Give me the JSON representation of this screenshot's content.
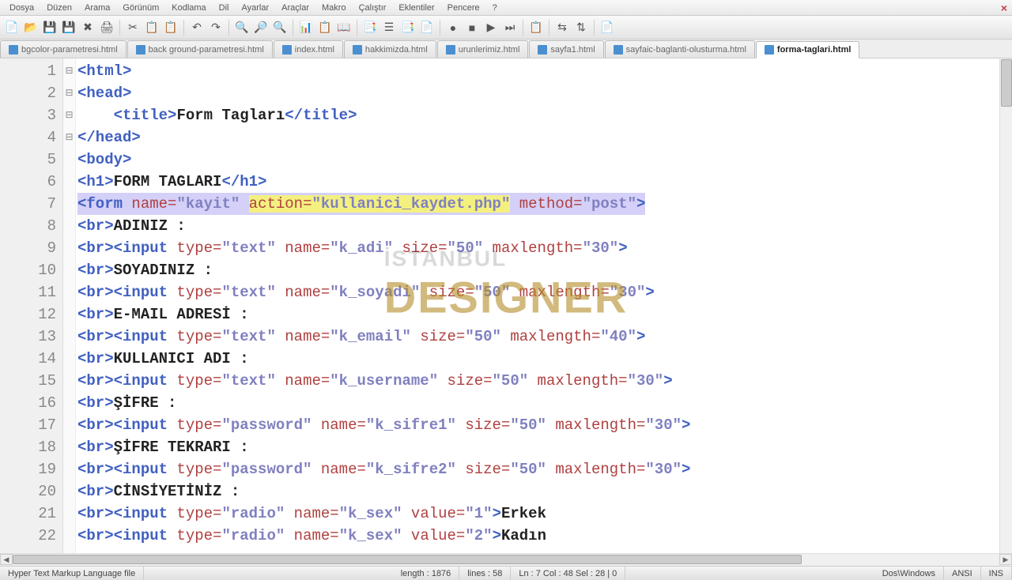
{
  "menu": {
    "items": [
      "Dosya",
      "Düzen",
      "Arama",
      "Görünüm",
      "Kodlama",
      "Dil",
      "Ayarlar",
      "Araçlar",
      "Makro",
      "Çalıştır",
      "Eklentiler",
      "Pencere",
      "?"
    ]
  },
  "tabs": [
    {
      "label": "bgcolor-parametresi.html",
      "active": false
    },
    {
      "label": "back ground-parametresi.html",
      "active": false
    },
    {
      "label": "index.html",
      "active": false
    },
    {
      "label": "hakkimizda.html",
      "active": false
    },
    {
      "label": "urunlerimiz.html",
      "active": false
    },
    {
      "label": "sayfa1.html",
      "active": false
    },
    {
      "label": "sayfaic-baglanti-olusturma.html",
      "active": false
    },
    {
      "label": "forma-taglari.html",
      "active": true
    }
  ],
  "lines": [
    {
      "n": 1,
      "fold": "⊟",
      "segs": [
        {
          "c": "tag",
          "t": "<html>"
        }
      ]
    },
    {
      "n": 2,
      "fold": "⊟",
      "segs": [
        {
          "c": "tag",
          "t": "<head>"
        }
      ]
    },
    {
      "n": 3,
      "fold": "",
      "segs": [
        {
          "c": "",
          "t": "    "
        },
        {
          "c": "tag",
          "t": "<title>"
        },
        {
          "c": "txt",
          "t": "Form Tagları"
        },
        {
          "c": "tag",
          "t": "</title>"
        }
      ]
    },
    {
      "n": 4,
      "fold": "",
      "segs": [
        {
          "c": "tag",
          "t": "</head>"
        }
      ]
    },
    {
      "n": 5,
      "fold": "⊟",
      "segs": [
        {
          "c": "tag",
          "t": "<body>"
        }
      ]
    },
    {
      "n": 6,
      "fold": "",
      "segs": [
        {
          "c": "tag",
          "t": "<h1>"
        },
        {
          "c": "txt",
          "t": "FORM TAGLARI"
        },
        {
          "c": "tag",
          "t": "</h1>"
        }
      ]
    },
    {
      "n": 7,
      "fold": "⊟",
      "hl": true,
      "segs": [
        {
          "c": "tag",
          "t": "<form "
        },
        {
          "c": "attr",
          "t": "name="
        },
        {
          "c": "str",
          "t": "\"kayit\""
        },
        {
          "c": "",
          "t": " "
        },
        {
          "c": "attr hl-act",
          "t": "action="
        },
        {
          "c": "str hl-act",
          "t": "\"kullanici_kaydet.php\""
        },
        {
          "c": "",
          "t": " "
        },
        {
          "c": "attr",
          "t": "method="
        },
        {
          "c": "str",
          "t": "\"post\""
        },
        {
          "c": "tag",
          "t": ">"
        }
      ]
    },
    {
      "n": 8,
      "fold": "",
      "segs": [
        {
          "c": "tag",
          "t": "<br>"
        },
        {
          "c": "txt",
          "t": "ADINIZ :"
        }
      ]
    },
    {
      "n": 9,
      "fold": "",
      "segs": [
        {
          "c": "tag",
          "t": "<br><input "
        },
        {
          "c": "attr",
          "t": "type="
        },
        {
          "c": "str",
          "t": "\"text\""
        },
        {
          "c": "",
          "t": " "
        },
        {
          "c": "attr",
          "t": "name="
        },
        {
          "c": "str",
          "t": "\"k_adi\""
        },
        {
          "c": "",
          "t": " "
        },
        {
          "c": "attr",
          "t": "size="
        },
        {
          "c": "str",
          "t": "\"50\""
        },
        {
          "c": "",
          "t": " "
        },
        {
          "c": "attr",
          "t": "maxlength="
        },
        {
          "c": "str",
          "t": "\"30\""
        },
        {
          "c": "tag",
          "t": ">"
        }
      ]
    },
    {
      "n": 10,
      "fold": "",
      "segs": [
        {
          "c": "tag",
          "t": "<br>"
        },
        {
          "c": "txt",
          "t": "SOYADINIZ :"
        }
      ]
    },
    {
      "n": 11,
      "fold": "",
      "segs": [
        {
          "c": "tag",
          "t": "<br><input "
        },
        {
          "c": "attr",
          "t": "type="
        },
        {
          "c": "str",
          "t": "\"text\""
        },
        {
          "c": "",
          "t": " "
        },
        {
          "c": "attr",
          "t": "name="
        },
        {
          "c": "str",
          "t": "\"k_soyadi\""
        },
        {
          "c": "",
          "t": " "
        },
        {
          "c": "attr",
          "t": "size="
        },
        {
          "c": "str",
          "t": "\"50\""
        },
        {
          "c": "",
          "t": " "
        },
        {
          "c": "attr",
          "t": "maxlength="
        },
        {
          "c": "str",
          "t": "\"30\""
        },
        {
          "c": "tag",
          "t": ">"
        }
      ]
    },
    {
      "n": 12,
      "fold": "",
      "segs": [
        {
          "c": "tag",
          "t": "<br>"
        },
        {
          "c": "txt",
          "t": "E-MAIL ADRESİ :"
        }
      ]
    },
    {
      "n": 13,
      "fold": "",
      "segs": [
        {
          "c": "tag",
          "t": "<br><input "
        },
        {
          "c": "attr",
          "t": "type="
        },
        {
          "c": "str",
          "t": "\"text\""
        },
        {
          "c": "",
          "t": " "
        },
        {
          "c": "attr",
          "t": "name="
        },
        {
          "c": "str",
          "t": "\"k_email\""
        },
        {
          "c": "",
          "t": " "
        },
        {
          "c": "attr",
          "t": "size="
        },
        {
          "c": "str",
          "t": "\"50\""
        },
        {
          "c": "",
          "t": " "
        },
        {
          "c": "attr",
          "t": "maxlength="
        },
        {
          "c": "str",
          "t": "\"40\""
        },
        {
          "c": "tag",
          "t": ">"
        }
      ]
    },
    {
      "n": 14,
      "fold": "",
      "segs": [
        {
          "c": "tag",
          "t": "<br>"
        },
        {
          "c": "txt",
          "t": "KULLANICI ADI :"
        }
      ]
    },
    {
      "n": 15,
      "fold": "",
      "segs": [
        {
          "c": "tag",
          "t": "<br><input "
        },
        {
          "c": "attr",
          "t": "type="
        },
        {
          "c": "str",
          "t": "\"text\""
        },
        {
          "c": "",
          "t": " "
        },
        {
          "c": "attr",
          "t": "name="
        },
        {
          "c": "str",
          "t": "\"k_username\""
        },
        {
          "c": "",
          "t": " "
        },
        {
          "c": "attr",
          "t": "size="
        },
        {
          "c": "str",
          "t": "\"50\""
        },
        {
          "c": "",
          "t": " "
        },
        {
          "c": "attr",
          "t": "maxlength="
        },
        {
          "c": "str",
          "t": "\"30\""
        },
        {
          "c": "tag",
          "t": ">"
        }
      ]
    },
    {
      "n": 16,
      "fold": "",
      "segs": [
        {
          "c": "tag",
          "t": "<br>"
        },
        {
          "c": "txt",
          "t": "ŞİFRE :"
        }
      ]
    },
    {
      "n": 17,
      "fold": "",
      "segs": [
        {
          "c": "tag",
          "t": "<br><input "
        },
        {
          "c": "attr",
          "t": "type="
        },
        {
          "c": "str",
          "t": "\"password\""
        },
        {
          "c": "",
          "t": " "
        },
        {
          "c": "attr",
          "t": "name="
        },
        {
          "c": "str",
          "t": "\"k_sifre1\""
        },
        {
          "c": "",
          "t": " "
        },
        {
          "c": "attr",
          "t": "size="
        },
        {
          "c": "str",
          "t": "\"50\""
        },
        {
          "c": "",
          "t": " "
        },
        {
          "c": "attr",
          "t": "maxlength="
        },
        {
          "c": "str",
          "t": "\"30\""
        },
        {
          "c": "tag",
          "t": ">"
        }
      ]
    },
    {
      "n": 18,
      "fold": "",
      "segs": [
        {
          "c": "tag",
          "t": "<br>"
        },
        {
          "c": "txt",
          "t": "ŞİFRE TEKRARI :"
        }
      ]
    },
    {
      "n": 19,
      "fold": "",
      "segs": [
        {
          "c": "tag",
          "t": "<br><input "
        },
        {
          "c": "attr",
          "t": "type="
        },
        {
          "c": "str",
          "t": "\"password\""
        },
        {
          "c": "",
          "t": " "
        },
        {
          "c": "attr",
          "t": "name="
        },
        {
          "c": "str",
          "t": "\"k_sifre2\""
        },
        {
          "c": "",
          "t": " "
        },
        {
          "c": "attr",
          "t": "size="
        },
        {
          "c": "str",
          "t": "\"50\""
        },
        {
          "c": "",
          "t": " "
        },
        {
          "c": "attr",
          "t": "maxlength="
        },
        {
          "c": "str",
          "t": "\"30\""
        },
        {
          "c": "tag",
          "t": ">"
        }
      ]
    },
    {
      "n": 20,
      "fold": "",
      "segs": [
        {
          "c": "tag",
          "t": "<br>"
        },
        {
          "c": "txt",
          "t": "CİNSİYETİNİZ :"
        }
      ]
    },
    {
      "n": 21,
      "fold": "",
      "segs": [
        {
          "c": "tag",
          "t": "<br><input "
        },
        {
          "c": "attr",
          "t": "type="
        },
        {
          "c": "str",
          "t": "\"radio\""
        },
        {
          "c": "",
          "t": " "
        },
        {
          "c": "attr",
          "t": "name="
        },
        {
          "c": "str",
          "t": "\"k_sex\""
        },
        {
          "c": "",
          "t": " "
        },
        {
          "c": "attr",
          "t": "value="
        },
        {
          "c": "str",
          "t": "\"1\""
        },
        {
          "c": "tag",
          "t": ">"
        },
        {
          "c": "txt",
          "t": "Erkek"
        }
      ]
    },
    {
      "n": 22,
      "fold": "",
      "segs": [
        {
          "c": "tag",
          "t": "<br><input "
        },
        {
          "c": "attr",
          "t": "type="
        },
        {
          "c": "str",
          "t": "\"radio\""
        },
        {
          "c": "",
          "t": " "
        },
        {
          "c": "attr",
          "t": "name="
        },
        {
          "c": "str",
          "t": "\"k_sex\""
        },
        {
          "c": "",
          "t": " "
        },
        {
          "c": "attr",
          "t": "value="
        },
        {
          "c": "str",
          "t": "\"2\""
        },
        {
          "c": "tag",
          "t": ">"
        },
        {
          "c": "txt",
          "t": "Kadın"
        }
      ]
    }
  ],
  "status": {
    "filetype": "Hyper Text Markup Language file",
    "length": "length : 1876",
    "lines": "lines : 58",
    "pos": "Ln : 7    Col : 48    Sel : 28 | 0",
    "eol": "Dos\\Windows",
    "enc": "ANSI",
    "ins": "INS"
  },
  "toolbar_icons": [
    "📄",
    "📂",
    "💾",
    "💾",
    "✖",
    "🖨",
    "",
    "✂",
    "📋",
    "📋",
    "",
    "↶",
    "↷",
    "",
    "🔍",
    "🔎",
    "🔍",
    "",
    "📊",
    "📋",
    "📖",
    "",
    "📑",
    "☰",
    "📑",
    "📄",
    "",
    "●",
    "■",
    "▶",
    "⏭",
    "",
    "📋",
    "",
    "⇆",
    "⇅",
    "",
    "📄"
  ]
}
